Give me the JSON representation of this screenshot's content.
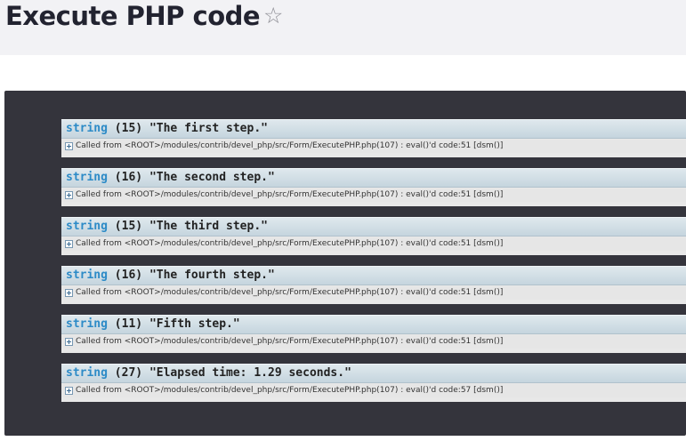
{
  "page": {
    "title": "Execute PHP code",
    "favorite_icon": "star-outline-icon",
    "favorite_glyph": "☆"
  },
  "output": {
    "dumps": [
      {
        "type": "string",
        "length": "(15)",
        "value": "\"The first step.\"",
        "called_from": "Called from <ROOT>/modules/contrib/devel_php/src/Form/ExecutePHP.php(107) : eval()'d code:51 [dsm()]"
      },
      {
        "type": "string",
        "length": "(16)",
        "value": "\"The second step.\"",
        "called_from": "Called from <ROOT>/modules/contrib/devel_php/src/Form/ExecutePHP.php(107) : eval()'d code:51 [dsm()]"
      },
      {
        "type": "string",
        "length": "(15)",
        "value": "\"The third step.\"",
        "called_from": "Called from <ROOT>/modules/contrib/devel_php/src/Form/ExecutePHP.php(107) : eval()'d code:51 [dsm()]"
      },
      {
        "type": "string",
        "length": "(16)",
        "value": "\"The fourth step.\"",
        "called_from": "Called from <ROOT>/modules/contrib/devel_php/src/Form/ExecutePHP.php(107) : eval()'d code:51 [dsm()]"
      },
      {
        "type": "string",
        "length": "(11)",
        "value": "\"Fifth step.\"",
        "called_from": "Called from <ROOT>/modules/contrib/devel_php/src/Form/ExecutePHP.php(107) : eval()'d code:51 [dsm()]"
      },
      {
        "type": "string",
        "length": "(27)",
        "value": "\"Elapsed time: 1.29 seconds.\"",
        "called_from": "Called from <ROOT>/modules/contrib/devel_php/src/Form/ExecutePHP.php(107) : eval()'d code:57 [dsm()]"
      }
    ]
  },
  "colors": {
    "header_bg": "#f2f2f5",
    "panel_bg": "#34343c",
    "type_keyword": "#2d8bc7",
    "dump_header": "#c5d5de",
    "dump_footer": "#e6e6e6"
  }
}
